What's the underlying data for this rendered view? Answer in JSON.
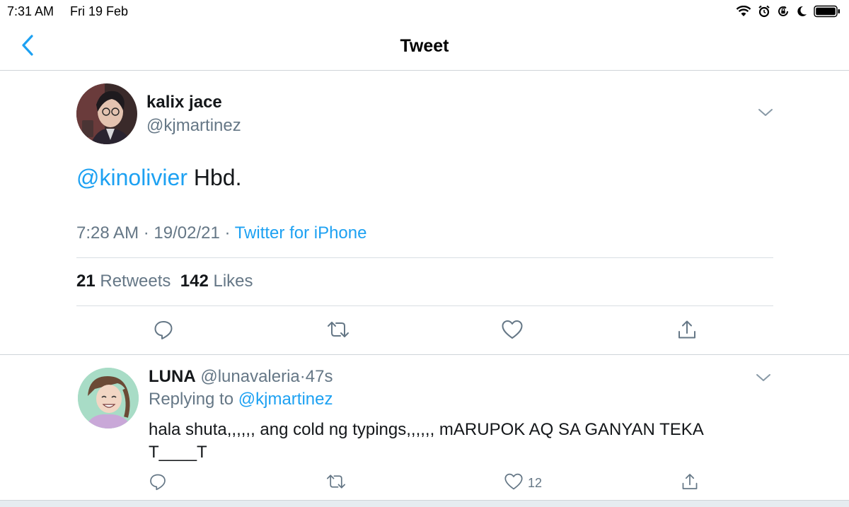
{
  "status_bar": {
    "time": "7:31 AM",
    "date": "Fri 19 Feb",
    "icons": [
      "wifi-icon",
      "alarm-icon",
      "rotation-lock-icon",
      "moon-icon",
      "battery-icon"
    ]
  },
  "nav": {
    "title": "Tweet",
    "back_icon": "chevron-left-icon"
  },
  "tweet": {
    "author_name": "kalix jace",
    "author_handle": "@kjmartinez",
    "mention": "@kinolivier",
    "text": " Hbd.",
    "time": "7:28 AM",
    "separator": " · ",
    "date": "19/02/21",
    "source_separator": " · ",
    "source": "Twitter for iPhone",
    "retweet_count": "21",
    "retweet_label": "Retweets",
    "like_count": "142",
    "like_label": "Likes"
  },
  "reply": {
    "author_name": "LUNA",
    "author_handle": "@lunavaleria",
    "dot": "·",
    "time": "47s",
    "replying_prefix": "Replying to ",
    "replying_handle": "@kjmartinez",
    "text": "hala shuta,,,,,, ang cold ng typings,,,,,, mARUPOK AQ SA GANYAN TEKA T____T",
    "like_count": "12"
  },
  "colors": {
    "accent": "#1da1f2",
    "secondary_text": "#657786",
    "primary_text": "#14171a",
    "divider": "#d9dee3"
  }
}
